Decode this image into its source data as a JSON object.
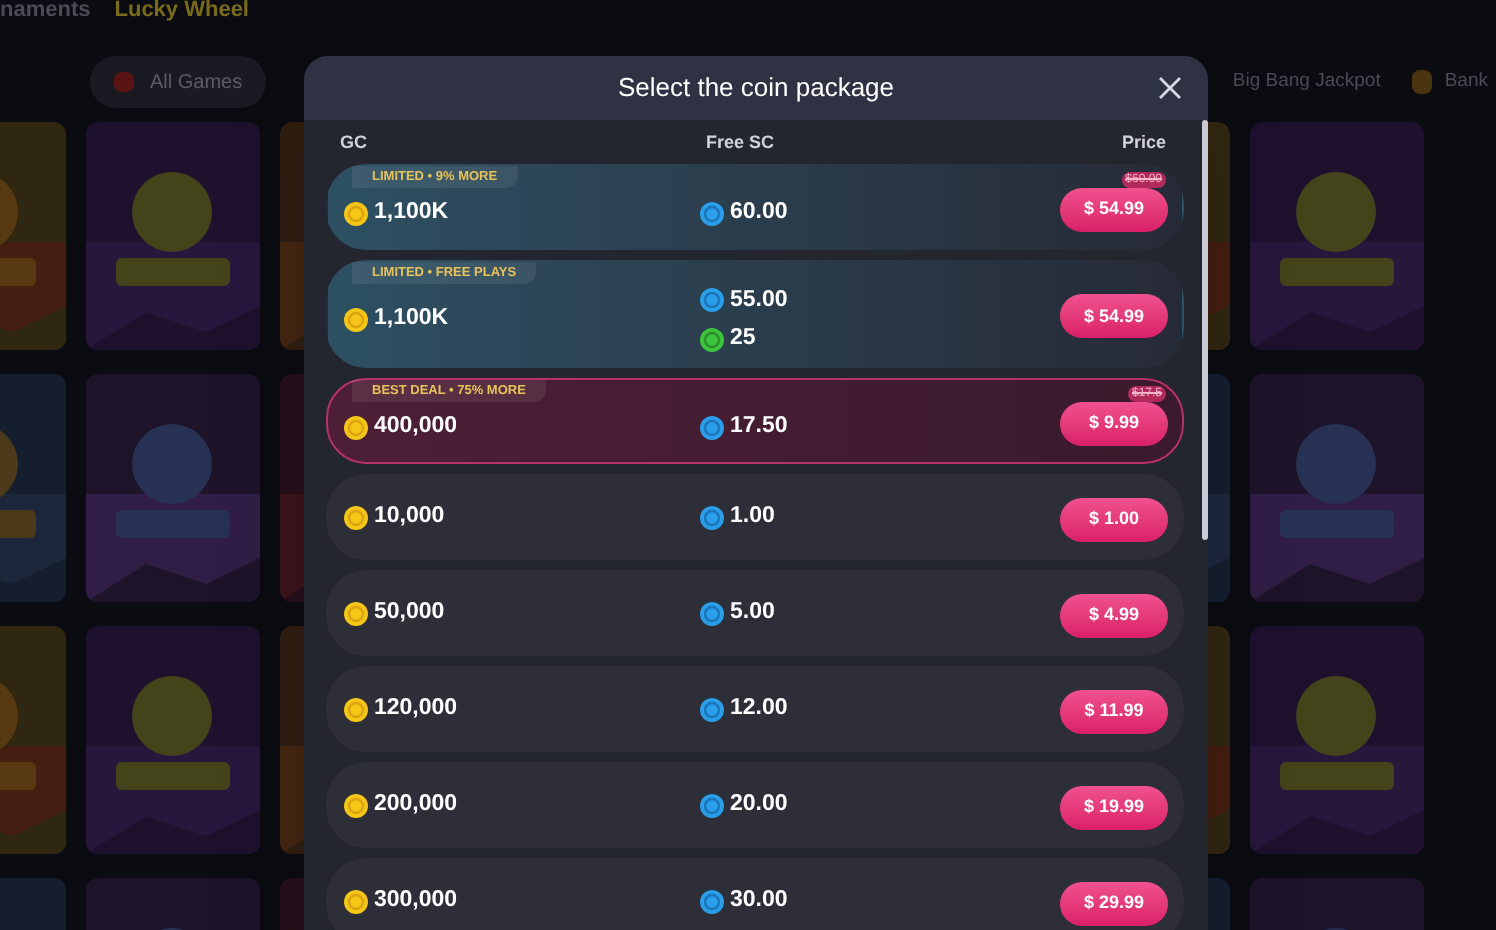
{
  "top_nav": [
    {
      "label": "naments",
      "selected": false
    },
    {
      "label": "Lucky Wheel",
      "selected": true
    }
  ],
  "categories": [
    {
      "label": "All Games",
      "selected": true
    },
    {
      "label": "Big Bang Jackpot",
      "selected": false
    },
    {
      "label": "Bank",
      "selected": false
    }
  ],
  "modal": {
    "title": "Select the coin package",
    "columns": [
      "GC",
      "Free SC",
      "Price"
    ],
    "packages": [
      {
        "kind": "limited",
        "badge": "LIMITED • 9% MORE",
        "gc": "1,100K",
        "free": [
          {
            "kind": "sc",
            "amount": "60.00"
          }
        ],
        "price": "$ 54.99",
        "old_price": "$60.00"
      },
      {
        "kind": "limited",
        "badge": "LIMITED • FREE PLAYS",
        "gc": "1,100K",
        "free": [
          {
            "kind": "sc",
            "amount": "55.00"
          },
          {
            "kind": "fp",
            "amount": "25"
          }
        ],
        "price": "$ 54.99"
      },
      {
        "kind": "best",
        "badge": "BEST DEAL • 75% MORE",
        "gc": "400,000",
        "free": [
          {
            "kind": "sc",
            "amount": "17.50"
          }
        ],
        "price": "$ 9.99",
        "old_price": "$17.5"
      },
      {
        "kind": "regular",
        "gc": "10,000",
        "free": [
          {
            "kind": "sc",
            "amount": "1.00"
          }
        ],
        "price": "$ 1.00"
      },
      {
        "kind": "regular",
        "gc": "50,000",
        "free": [
          {
            "kind": "sc",
            "amount": "5.00"
          }
        ],
        "price": "$ 4.99"
      },
      {
        "kind": "regular",
        "gc": "120,000",
        "free": [
          {
            "kind": "sc",
            "amount": "12.00"
          }
        ],
        "price": "$ 11.99"
      },
      {
        "kind": "regular",
        "gc": "200,000",
        "free": [
          {
            "kind": "sc",
            "amount": "20.00"
          }
        ],
        "price": "$ 19.99"
      },
      {
        "kind": "regular",
        "gc": "300,000",
        "free": [
          {
            "kind": "sc",
            "amount": "30.00"
          }
        ],
        "price": "$ 29.99"
      }
    ]
  }
}
